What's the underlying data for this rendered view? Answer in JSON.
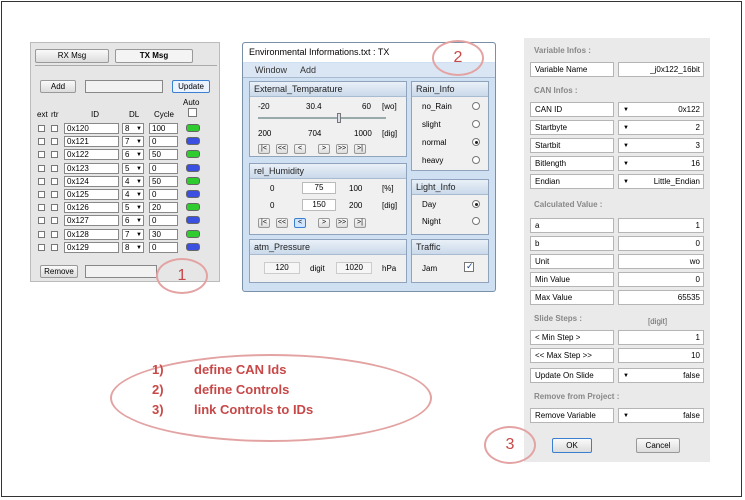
{
  "panel1": {
    "tabs": [
      "RX Msg",
      "TX Msg"
    ],
    "add_label": "Add",
    "update_label": "Update",
    "auto_label": "Auto",
    "columns": [
      "ext",
      "rtr",
      "ID",
      "DL",
      "Cycle"
    ],
    "rows": [
      {
        "id": "0x120",
        "dl": "8",
        "cycle": "100",
        "led": "#2fcc2f"
      },
      {
        "id": "0x121",
        "dl": "7",
        "cycle": "0",
        "led": "#3b4fe0"
      },
      {
        "id": "0x122",
        "dl": "6",
        "cycle": "50",
        "led": "#2fcc2f"
      },
      {
        "id": "0x123",
        "dl": "5",
        "cycle": "0",
        "led": "#3b4fe0"
      },
      {
        "id": "0x124",
        "dl": "4",
        "cycle": "50",
        "led": "#2fcc2f"
      },
      {
        "id": "0x125",
        "dl": "4",
        "cycle": "0",
        "led": "#3b4fe0"
      },
      {
        "id": "0x126",
        "dl": "5",
        "cycle": "20",
        "led": "#2fcc2f"
      },
      {
        "id": "0x127",
        "dl": "6",
        "cycle": "0",
        "led": "#3b4fe0"
      },
      {
        "id": "0x128",
        "dl": "7",
        "cycle": "30",
        "led": "#2fcc2f"
      },
      {
        "id": "0x129",
        "dl": "8",
        "cycle": "0",
        "led": "#3b4fe0"
      }
    ],
    "remove_label": "Remove"
  },
  "panel2": {
    "title": "Environmental Informations.txt : TX",
    "menu": [
      "Window",
      "Add"
    ],
    "ext_temp": {
      "title": "External_Temparature",
      "min": "-20",
      "value": "30.4",
      "max": "60",
      "unit": "[wo]",
      "dig_min": "200",
      "dig_value": "704",
      "dig_max": "1000",
      "dig_unit": "[dig]",
      "slider_fraction": 0.63,
      "nav": [
        "|<",
        "<<",
        "<",
        ">",
        ">>",
        ">|"
      ]
    },
    "rel_hum": {
      "title": "rel_Humidity",
      "min": "0",
      "value": "75",
      "max": "100",
      "unit": "[%]",
      "dig_min": "0",
      "dig_value": "150",
      "dig_max": "200",
      "dig_unit": "[dig]",
      "nav": [
        "|<",
        "<<",
        "<",
        ">",
        ">>",
        ">|"
      ]
    },
    "atm": {
      "title": "atm_Pressure",
      "value": "120",
      "digit_label": "digit",
      "hpa_value": "1020",
      "hpa_label": "hPa"
    },
    "rain": {
      "title": "Rain_Info",
      "options": [
        "no_Rain",
        "slight",
        "normal",
        "heavy"
      ],
      "selected": "normal"
    },
    "light": {
      "title": "Light_Info",
      "options": [
        "Day",
        "Night"
      ],
      "selected": "Day"
    },
    "traffic": {
      "title": "Traffic",
      "label": "Jam"
    }
  },
  "panel3": {
    "variable_infos": "Variable Infos :",
    "variable_name_label": "Variable Name",
    "variable_name_value": "_j0x122_16bit",
    "can_infos": "CAN Infos :",
    "can_rows": [
      {
        "label": "CAN ID",
        "value": "0x122"
      },
      {
        "label": "Startbyte",
        "value": "2"
      },
      {
        "label": "Startbit",
        "value": "3"
      },
      {
        "label": "Bitlength",
        "value": "16"
      },
      {
        "label": "Endian",
        "value": "Little_Endian"
      }
    ],
    "calculated": "Calculated Value :",
    "calc_rows": [
      {
        "label": "a",
        "value": "1"
      },
      {
        "label": "b",
        "value": "0"
      },
      {
        "label": "Unit",
        "value": "wo"
      },
      {
        "label": "Min Value",
        "value": "0"
      },
      {
        "label": "Max Value",
        "value": "65535"
      }
    ],
    "slide_steps": "Slide Steps :",
    "slide_unit": "[digit]",
    "slide_rows": [
      {
        "label": "<   Min Step   >",
        "value": "1"
      },
      {
        "label": "<< Max Step >>",
        "value": "10"
      }
    ],
    "update_on_slide": {
      "label": "Update On Slide",
      "value": "false"
    },
    "remove_from_project": "Remove from Project :",
    "remove_variable": {
      "label": "Remove Variable",
      "value": "false"
    },
    "ok_label": "OK",
    "cancel_label": "Cancel"
  },
  "callouts": [
    "1",
    "2",
    "3"
  ],
  "steps": [
    {
      "num": "1)",
      "text": "define CAN Ids"
    },
    {
      "num": "2)",
      "text": "define Controls"
    },
    {
      "num": "3)",
      "text": "link Controls to IDs"
    }
  ]
}
